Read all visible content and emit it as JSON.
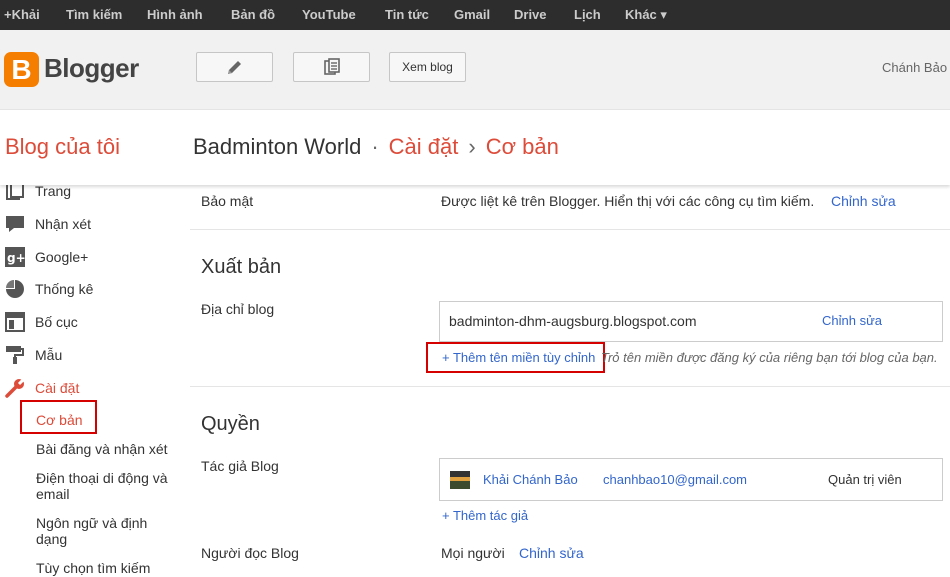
{
  "gbar": {
    "items": [
      "+Khải",
      "Tìm kiếm",
      "Hình ảnh",
      "Bản đồ",
      "YouTube",
      "Tin tức",
      "Gmail",
      "Drive",
      "Lịch",
      "Khác ▾"
    ]
  },
  "header": {
    "logo_letter": "B",
    "logo_text": "Blogger",
    "view_blog_label": "Xem blog",
    "username": "Chánh Bảo"
  },
  "titlebar": {
    "my_blogs": "Blog của tôi",
    "blog_name": "Badminton World",
    "dot": "·",
    "settings": "Cài đặt",
    "arrow": "›",
    "basic": "Cơ bản"
  },
  "sidebar": {
    "items": [
      {
        "label": "Trang",
        "icon": "pages-icon"
      },
      {
        "label": "Nhận xét",
        "icon": "comments-icon"
      },
      {
        "label": "Google+",
        "icon": "google-plus-icon"
      },
      {
        "label": "Thống kê",
        "icon": "stats-icon"
      },
      {
        "label": "Bố cục",
        "icon": "layout-icon"
      },
      {
        "label": "Mẫu",
        "icon": "template-icon"
      },
      {
        "label": "Cài đặt",
        "icon": "wrench-icon"
      }
    ],
    "subitems": [
      "Cơ bản",
      "Bài đăng và nhận xét",
      "Điện thoại di động và email",
      "Ngôn ngữ và định dạng",
      "Tùy chọn tìm kiếm"
    ]
  },
  "main": {
    "privacy_label": "Bảo mật",
    "privacy_value": "Được liệt kê trên Blogger. Hiển thị với các công cụ tìm kiếm.",
    "edit_label": "Chỉnh sửa",
    "publishing_title": "Xuất bản",
    "blog_address_label": "Địa chỉ blog",
    "blog_address": "badminton-dhm-augsburg.blogspot.com",
    "add_domain": "+ Thêm tên miền tùy chỉnh",
    "domain_hint": "Trỏ tên miền được đăng ký của riêng bạn tới blog của bạn.",
    "permissions_title": "Quyền",
    "authors_label": "Tác giả Blog",
    "author_name": "Khải Chánh Bảo",
    "author_email": "chanhbao10@gmail.com",
    "author_role": "Quản trị viên",
    "add_author": "+ Thêm tác giả",
    "readers_label": "Người đọc Blog",
    "readers_value": "Mọi người"
  },
  "colors": {
    "accent": "#dd4b39",
    "link": "#3366cc",
    "highlight_box": "#d50000",
    "logo": "#f57d00"
  }
}
